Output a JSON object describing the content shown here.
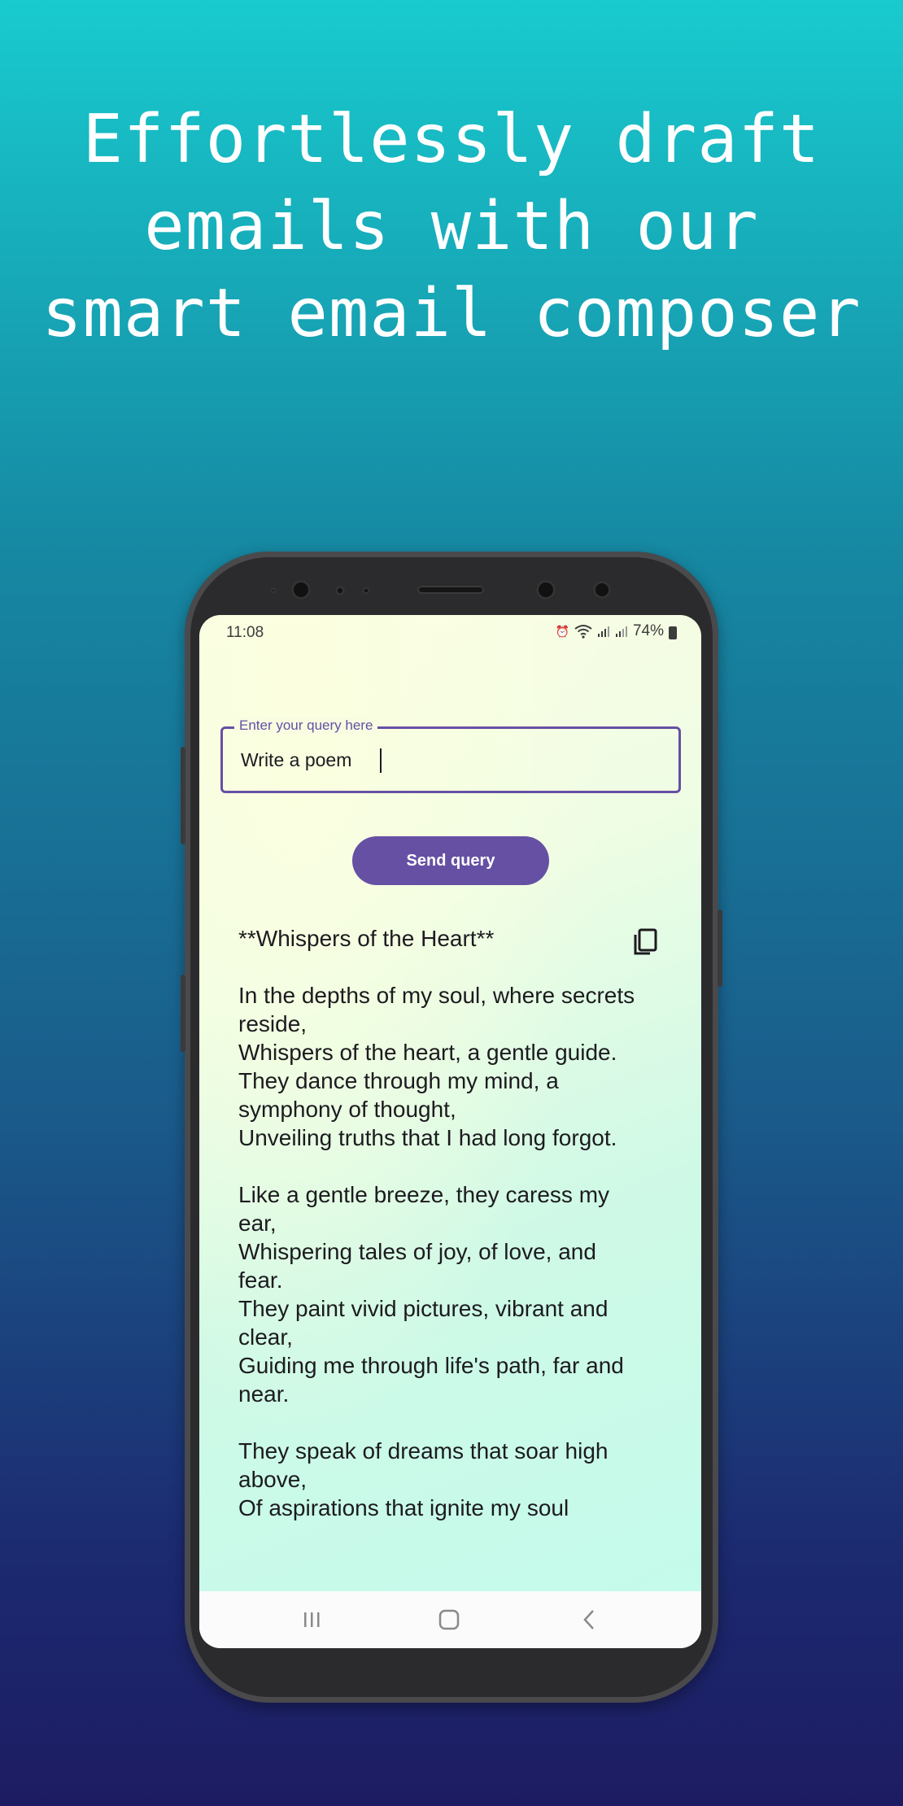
{
  "headline": "Effortlessly draft emails with our smart email composer",
  "status_bar": {
    "time": "11:08",
    "battery": "74%",
    "icons": [
      "alarm-icon",
      "wifi-icon",
      "signal-icon",
      "signal-icon",
      "battery-icon"
    ]
  },
  "query_field": {
    "label": "Enter your query here",
    "value": "Write a poem"
  },
  "send_button": {
    "label": "Send query"
  },
  "response": {
    "text": "**Whispers of the Heart**\n\nIn the depths of my soul, where secrets reside,\nWhispers of the heart, a gentle guide.\nThey dance through my mind, a symphony of thought,\nUnveiling truths that I had long forgot.\n\nLike a gentle breeze, they caress my ear,\nWhispering tales of joy, of love, and fear.\nThey paint vivid pictures, vibrant and clear,\nGuiding me through life's path, far and near.\n\nThey speak of dreams that soar high above,\nOf aspirations that ignite my soul",
    "copy_icon": "copy-icon"
  },
  "nav_bar": [
    "recents-icon",
    "home-icon",
    "back-icon"
  ],
  "colors": {
    "accent": "#6650a4",
    "background_top": "#18cbce",
    "background_bottom": "#1d1c62"
  }
}
